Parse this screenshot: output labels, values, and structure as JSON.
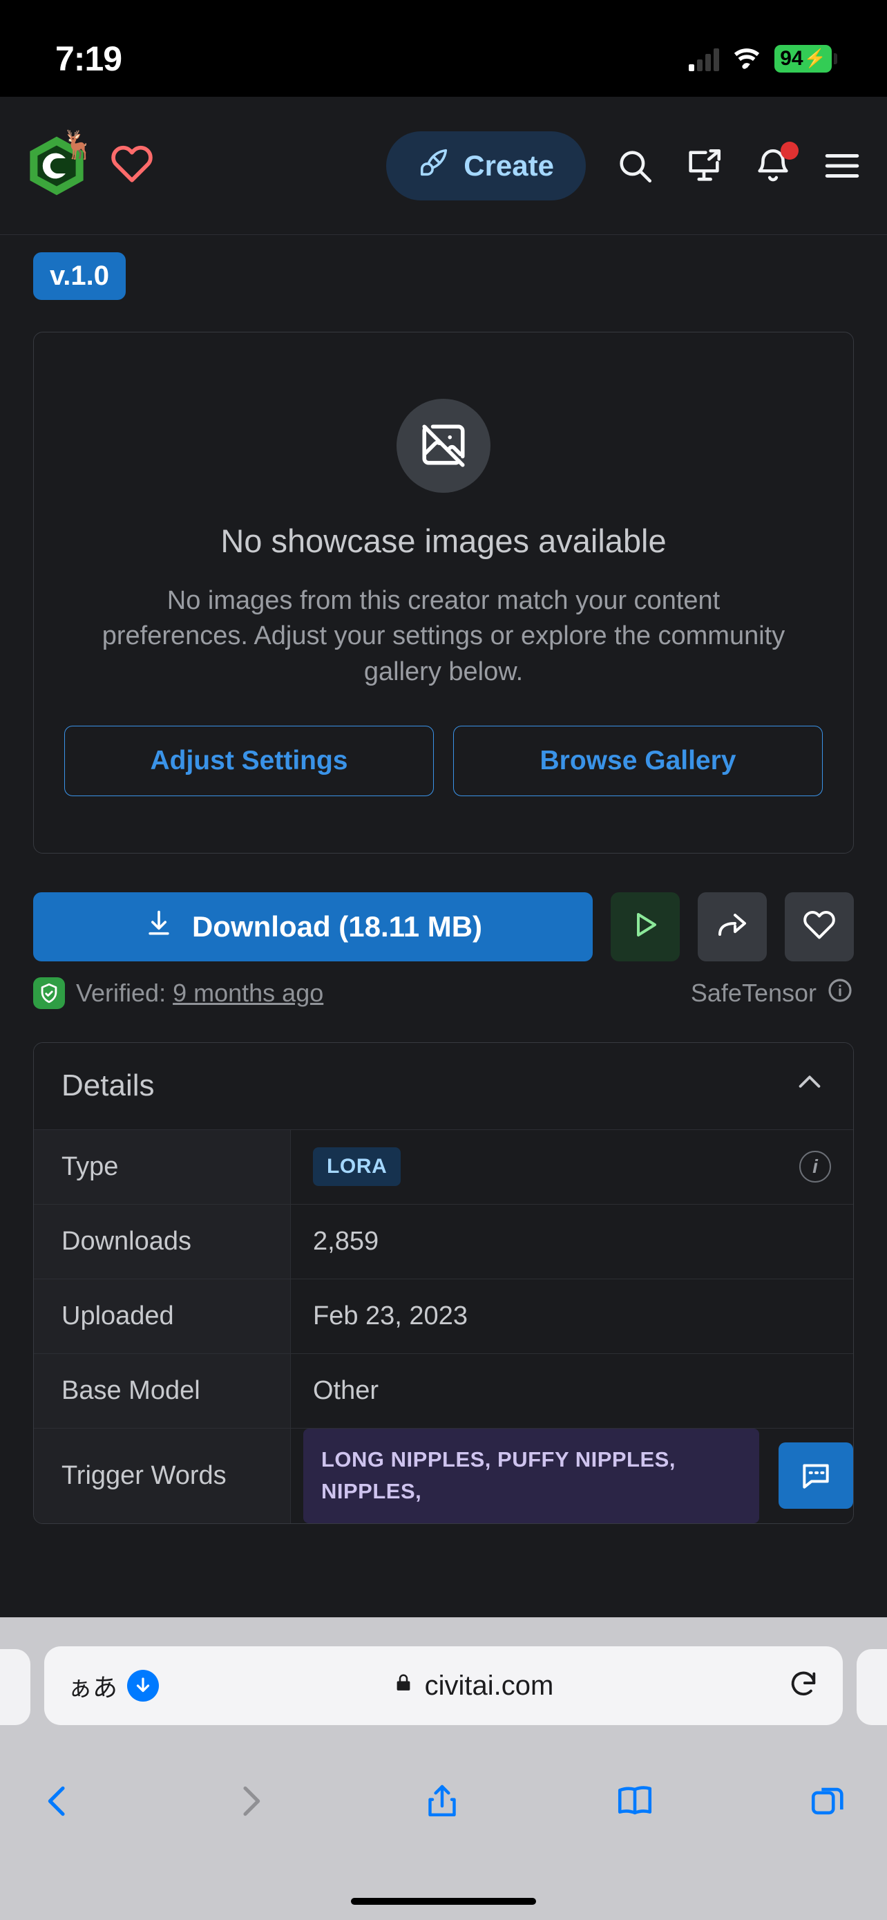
{
  "status_bar": {
    "time": "7:19",
    "battery_percent": "94",
    "battery_charging_icon": "bolt-icon",
    "wifi_icon": "wifi-icon",
    "cellular_icon": "cellular-signal-icon"
  },
  "header": {
    "logo_icon": "civitai-logo-icon",
    "logo_letter": "C",
    "decoration_icon": "reindeer-icon",
    "decoration_glyph": "🦌",
    "heart_icon": "heart-outline-icon",
    "create_label": "Create",
    "create_icon": "paintbrush-icon",
    "search_icon": "search-icon",
    "screen_share_icon": "screen-share-icon",
    "notifications_icon": "bell-icon",
    "notifications_has_badge": true,
    "menu_icon": "hamburger-menu-icon"
  },
  "version": {
    "badge_label": "v.1.0"
  },
  "showcase": {
    "empty_icon": "image-off-icon",
    "title": "No showcase images available",
    "description": "No images from this creator match your content preferences. Adjust your settings or explore the community gallery below.",
    "primary_button": "Adjust Settings",
    "secondary_button": "Browse Gallery"
  },
  "download": {
    "label": "Download (18.11 MB)",
    "download_icon": "download-icon",
    "run_icon": "play-icon",
    "share_icon": "share-arrow-icon",
    "favorite_icon": "heart-outline-icon",
    "verified_icon": "shield-check-icon",
    "verified_label": "Verified:",
    "verified_date": "9 months ago",
    "format_label": "SafeTensor",
    "format_info_icon": "info-icon"
  },
  "details": {
    "title": "Details",
    "collapse_icon": "chevron-up-icon",
    "rows": [
      {
        "key": "Type",
        "value": "LORA",
        "kind": "badge",
        "info_icon": "info-icon"
      },
      {
        "key": "Downloads",
        "value": "2,859",
        "kind": "text"
      },
      {
        "key": "Uploaded",
        "value": "Feb 23, 2023",
        "kind": "text"
      },
      {
        "key": "Base Model",
        "value": "Other",
        "kind": "text"
      },
      {
        "key": "Trigger Words",
        "value": "LONG NIPPLES, PUFFY NIPPLES, NIPPLES,",
        "kind": "chip",
        "copy_icon": "copy-chat-icon"
      }
    ]
  },
  "browser": {
    "text_size_label": "ぁあ",
    "downloads_icon": "download-arrow-icon",
    "lock_icon": "lock-icon",
    "url": "civitai.com",
    "reload_icon": "reload-icon",
    "back_icon": "chevron-left-icon",
    "forward_icon": "chevron-right-icon",
    "share_icon": "share-up-icon",
    "bookmarks_icon": "book-icon",
    "tabs_icon": "tabs-icon"
  },
  "colors": {
    "accent_blue": "#1971c2",
    "link_blue": "#3a93e8",
    "badge_blue": "#1971c2",
    "verified_green": "#2f9e44",
    "run_green": "#1b3523",
    "trigger_purple": "#2b2546",
    "page_bg": "#1a1b1e",
    "battery_green": "#33cc55",
    "notification_red": "#e03131",
    "heart_red": "#ff6b6b"
  }
}
